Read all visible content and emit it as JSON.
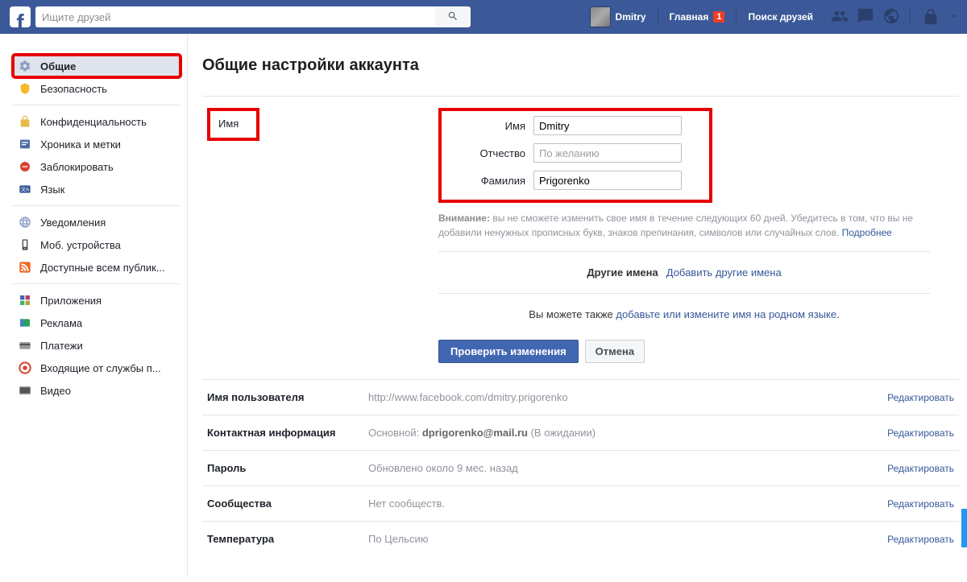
{
  "topbar": {
    "search_placeholder": "Ищите друзей",
    "user_name": "Dmitry",
    "home_label": "Главная",
    "home_badge": "1",
    "find_friends": "Поиск друзей"
  },
  "sidebar": {
    "groups": [
      {
        "items": [
          {
            "id": "general",
            "label": "Общие",
            "active": true,
            "icon": "gears-icon"
          },
          {
            "id": "security",
            "label": "Безопасность",
            "icon": "shield-icon"
          }
        ]
      },
      {
        "items": [
          {
            "id": "privacy",
            "label": "Конфиденциальность",
            "icon": "lock-icon"
          },
          {
            "id": "timeline",
            "label": "Хроника и метки",
            "icon": "card-icon"
          },
          {
            "id": "blocking",
            "label": "Заблокировать",
            "icon": "block-icon"
          },
          {
            "id": "language",
            "label": "Язык",
            "icon": "language-icon"
          }
        ]
      },
      {
        "items": [
          {
            "id": "notifications",
            "label": "Уведомления",
            "icon": "globe-icon"
          },
          {
            "id": "mobile",
            "label": "Моб. устройства",
            "icon": "phone-icon"
          },
          {
            "id": "publicposts",
            "label": "Доступные всем публик...",
            "icon": "rss-icon"
          }
        ]
      },
      {
        "items": [
          {
            "id": "apps",
            "label": "Приложения",
            "icon": "apps-icon"
          },
          {
            "id": "ads",
            "label": "Реклама",
            "icon": "ads-icon"
          },
          {
            "id": "payments",
            "label": "Платежи",
            "icon": "payments-icon"
          },
          {
            "id": "support",
            "label": "Входящие от службы п...",
            "icon": "support-icon"
          },
          {
            "id": "video",
            "label": "Видео",
            "icon": "video-icon"
          }
        ]
      }
    ]
  },
  "page": {
    "title": "Общие настройки аккаунта"
  },
  "name_section": {
    "heading": "Имя",
    "fields": {
      "first_name_label": "Имя",
      "first_name_value": "Dmitry",
      "middle_name_label": "Отчество",
      "middle_name_placeholder": "По желанию",
      "last_name_label": "Фамилия",
      "last_name_value": "Prigorenko"
    },
    "note_bold": "Внимание:",
    "note_text": " вы не сможете изменить свое имя в течение следующих 60 дней. Убедитесь в том, что вы не добавили ненужных прописных букв, знаков препинания, символов или случайных слов. ",
    "note_more": "Подробнее",
    "other_names_label": "Другие имена",
    "other_names_link": "Добавить другие имена",
    "native_prefix": "Вы можете также ",
    "native_link": "добавьте или измените имя на родном языке",
    "native_suffix": ".",
    "submit": "Проверить изменения",
    "cancel": "Отмена"
  },
  "rows": {
    "username": {
      "label": "Имя пользователя",
      "value": "http://www.facebook.com/dmitry.prigorenko",
      "edit": "Редактировать"
    },
    "contact": {
      "label": "Контактная информация",
      "prefix": "Основной: ",
      "email": "dprigorenko@mail.ru",
      "suffix": " (В ожидании)",
      "edit": "Редактировать"
    },
    "password": {
      "label": "Пароль",
      "value": "Обновлено около 9 мес. назад",
      "edit": "Редактировать"
    },
    "networks": {
      "label": "Сообщества",
      "value": "Нет сообществ.",
      "edit": "Редактировать"
    },
    "temp": {
      "label": "Температура",
      "value": "По Цельсию",
      "edit": "Редактировать"
    }
  }
}
